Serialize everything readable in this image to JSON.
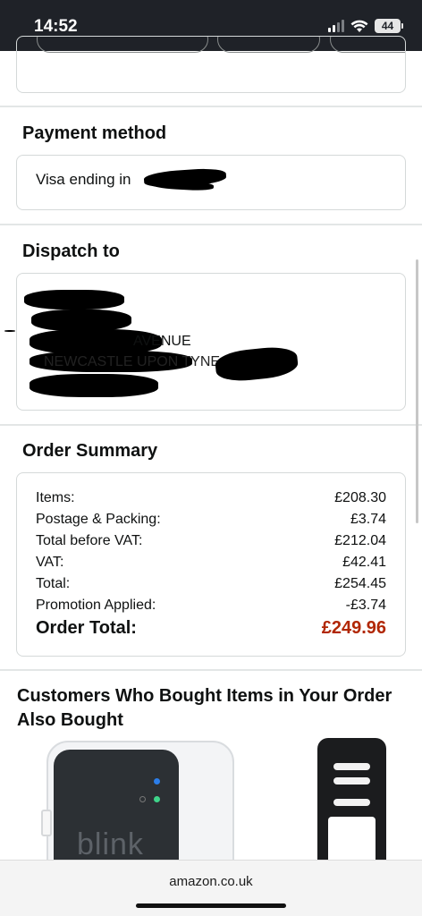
{
  "status_bar": {
    "time": "14:52",
    "battery": "44"
  },
  "payment": {
    "title": "Payment method",
    "card_text": "Visa  ending in"
  },
  "dispatch": {
    "title": "Dispatch to",
    "lines": [
      "AVENUE",
      "NEWCASTLE UPON TYNE"
    ]
  },
  "order_summary": {
    "title": "Order Summary",
    "rows": [
      {
        "label": "Items:",
        "value": "£208.30"
      },
      {
        "label": "Postage & Packing:",
        "value": "£3.74"
      },
      {
        "label": "Total before VAT:",
        "value": "£212.04"
      },
      {
        "label": "VAT:",
        "value": "£42.41"
      },
      {
        "label": "Total:",
        "value": "£254.45"
      },
      {
        "label": "Promotion Applied:",
        "value": "-£3.74"
      }
    ],
    "total_label": "Order Total:",
    "total_value": "£249.96",
    "total_color": "#b12704"
  },
  "recommendations": {
    "title": "Customers Who Bought Items in Your Order Also Bought",
    "products": [
      {
        "icon": "camera-mount-product-icon",
        "logo_text": "blink"
      },
      {
        "icon": "doorbell-holder-product-icon"
      }
    ]
  },
  "browser": {
    "url": "amazon.co.uk"
  }
}
